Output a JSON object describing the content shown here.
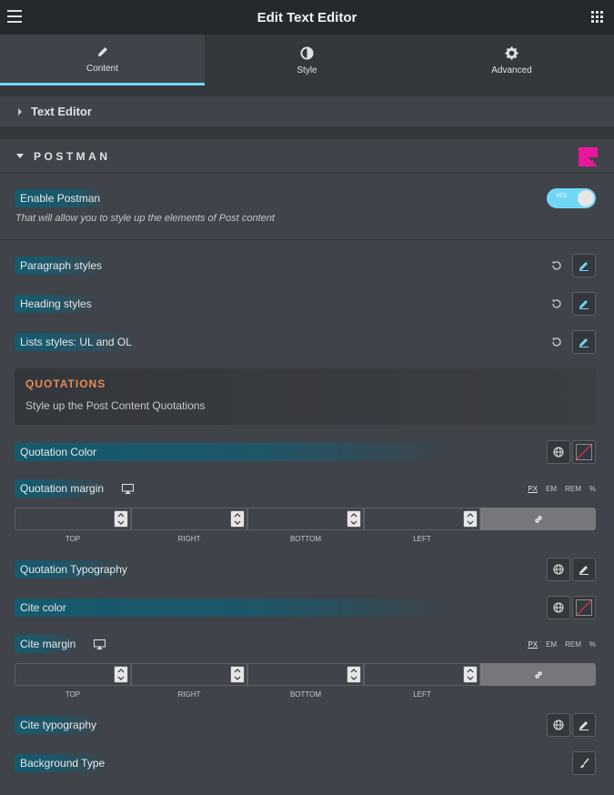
{
  "header": {
    "title": "Edit Text Editor",
    "menu_icon": "hamburger-icon",
    "apps_icon": "grid-icon"
  },
  "tabs": [
    {
      "label": "Content",
      "icon": "pencil-icon",
      "active": true
    },
    {
      "label": "Style",
      "icon": "half-circle-icon",
      "active": false
    },
    {
      "label": "Advanced",
      "icon": "gear-icon",
      "active": false
    }
  ],
  "sections": {
    "text_editor": {
      "label": "Text Editor",
      "expanded": false
    },
    "postman": {
      "label": "POSTMAN",
      "expanded": true
    }
  },
  "enable_postman": {
    "label": "Enable Postman",
    "toggle_text": "YES",
    "enabled": true,
    "description": "That will allow you to style up the elements of Post content"
  },
  "styles": [
    {
      "label": "Paragraph styles"
    },
    {
      "label": "Heading styles"
    },
    {
      "label": "Lists styles: UL and OL"
    }
  ],
  "quotations": {
    "title": "QUOTATIONS",
    "description": "Style up the Post Content Quotations"
  },
  "quotation_color": {
    "label": "Quotation Color"
  },
  "quotation_margin": {
    "label": "Quotation margin"
  },
  "units": [
    "PX",
    "EM",
    "REM",
    "%"
  ],
  "active_unit": "PX",
  "dimension_labels": [
    "TOP",
    "RIGHT",
    "BOTTOM",
    "LEFT"
  ],
  "quotation_typography": {
    "label": "Quotation Typography"
  },
  "cite_color": {
    "label": "Cite color"
  },
  "cite_margin": {
    "label": "Cite margin"
  },
  "cite_typography": {
    "label": "Cite typography"
  },
  "background_type": {
    "label": "Background Type"
  },
  "colors": {
    "accent": "#71d7f7",
    "brand": "#e8189c",
    "quotation_title": "#e48b57",
    "panel": "#404349",
    "topbar": "#26292c"
  }
}
